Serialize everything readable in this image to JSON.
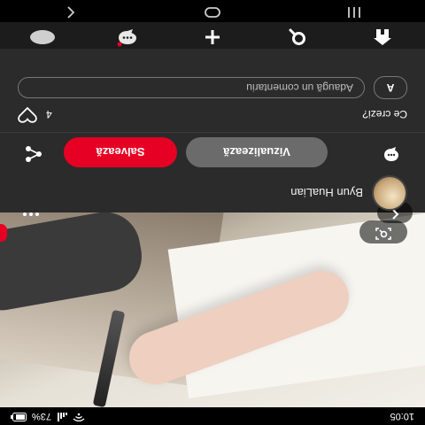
{
  "status_bar": {
    "time": "10:05",
    "battery": "73%"
  },
  "creator": {
    "name": "Byun HuaLian"
  },
  "actions": {
    "visit_label": "Vizualizează",
    "save_label": "Salvează"
  },
  "comments": {
    "heading": "Ce crezi?",
    "like_count": "4",
    "avatar_initial": "A",
    "input_placeholder": "Adaugă un comentariu"
  },
  "colors": {
    "accent": "#e60023",
    "background": "#2b2b2b",
    "pill_gray": "#6b6b6b"
  },
  "icons": {
    "top_left": "back-chevron-icon",
    "top_right": "more-dots-icon",
    "lens": "visual-search-icon",
    "tabbar": [
      "home-icon",
      "search-icon",
      "plus-icon",
      "chat-icon",
      "profile-icon"
    ],
    "navbar": [
      "recents-icon",
      "home-circle-icon",
      "back-icon"
    ]
  }
}
